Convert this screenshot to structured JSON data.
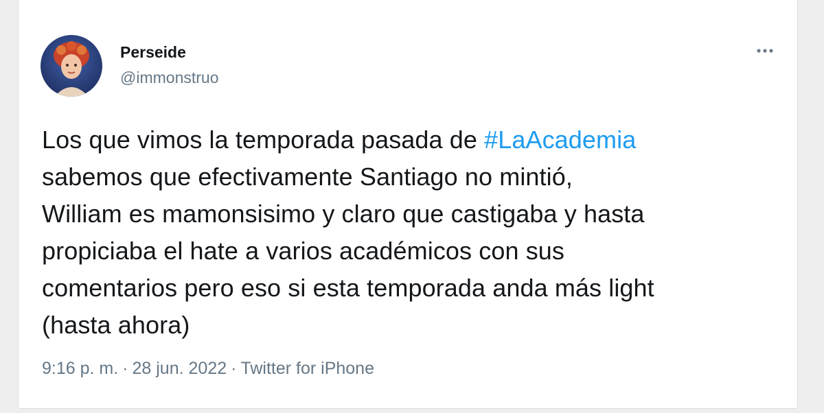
{
  "tweet": {
    "author": {
      "name": "Perseide",
      "handle": "@immonstruo"
    },
    "more_icon": "more-horizontal-icon",
    "body": {
      "line1_prefix": "Los que vimos la temporada pasada de ",
      "hashtag": "#LaAcademia",
      "line2": "sabemos que efectivamente Santiago no mintió,",
      "line3": "William es mamonsisimo y claro que castigaba y hasta",
      "line4": "propiciaba el hate a varios académicos con sus",
      "line5": "comentarios pero eso si esta temporada anda más light",
      "line6": "(hasta ahora)"
    },
    "meta": {
      "time": "9:16 p. m.",
      "separator": "·",
      "date": "28 jun. 2022",
      "source": "Twitter for iPhone"
    },
    "colors": {
      "link": "#1d9bf0",
      "text": "#14171a",
      "secondary": "#657786"
    }
  }
}
